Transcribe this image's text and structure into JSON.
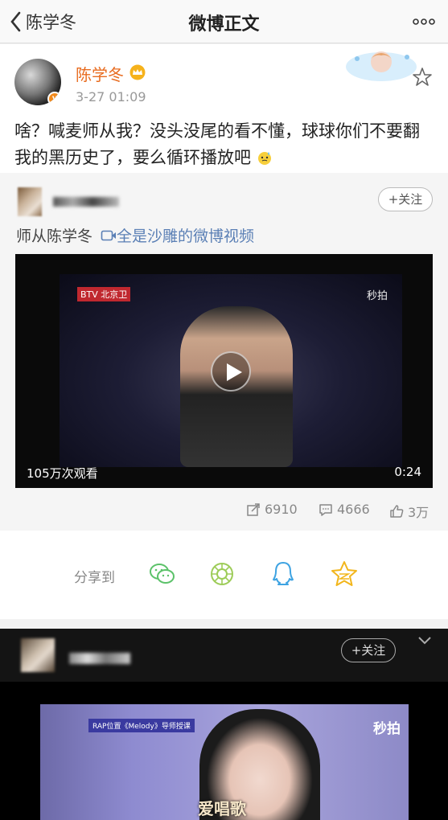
{
  "nav": {
    "back_label": "陈学冬",
    "title": "微博正文",
    "icons": {
      "back": "chevron-left-icon",
      "more": "more-dots-icon"
    }
  },
  "post": {
    "author": "陈学冬",
    "time": "3-27 01:09",
    "text": "啥？喊麦师从我？没头没尾的看不懂，球球你们不要翻我的黑历史了，要么循环播放吧",
    "colors": {
      "author": "#e86b1f",
      "verified": "#f28a1c"
    },
    "icons": {
      "crown": "crown-icon",
      "star": "favorite-star-icon",
      "emoji": "sweat-emoji-icon"
    }
  },
  "repost": {
    "follow_label": "+关注",
    "text_prefix": "师从陈学冬 ",
    "link_text": "全是沙雕的微博视频",
    "video": {
      "channel": "BTV 北京卫",
      "platform": "秒拍",
      "views": "105万次观看",
      "duration": "0:24"
    },
    "stats": {
      "reposts": "6910",
      "comments": "4666",
      "likes": "3万"
    }
  },
  "share": {
    "label": "分享到",
    "targets": [
      "wechat-icon",
      "moments-icon",
      "qq-icon",
      "qzone-icon"
    ]
  },
  "post2": {
    "follow_label": "+关注",
    "video": {
      "tag": "RAP位置《Melody》导师授课",
      "platform": "秒拍"
    }
  },
  "watermark": "爱唱歌"
}
